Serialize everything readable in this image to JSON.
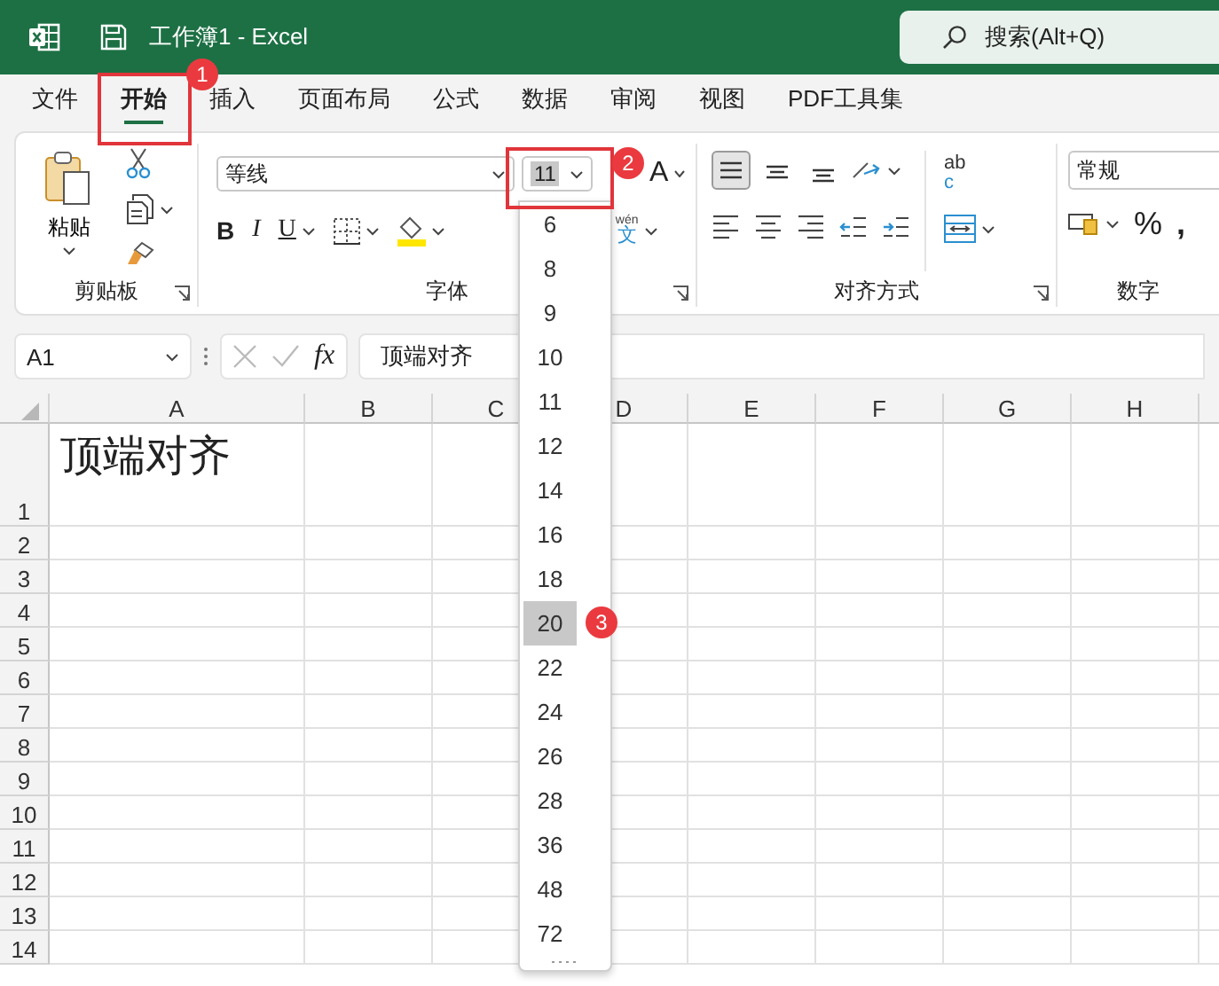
{
  "window": {
    "title": "工作簿1 - Excel"
  },
  "search": {
    "placeholder": "搜索(Alt+Q)"
  },
  "tabs": [
    {
      "label": "文件",
      "selected": false
    },
    {
      "label": "开始",
      "selected": true
    },
    {
      "label": "插入",
      "selected": false
    },
    {
      "label": "页面布局",
      "selected": false
    },
    {
      "label": "公式",
      "selected": false
    },
    {
      "label": "数据",
      "selected": false
    },
    {
      "label": "审阅",
      "selected": false
    },
    {
      "label": "视图",
      "selected": false
    },
    {
      "label": "PDF工具集",
      "selected": false
    }
  ],
  "ribbon": {
    "clipboard": {
      "paste_label": "粘贴",
      "group_label": "剪贴板"
    },
    "font": {
      "font_name": "等线",
      "font_size": "11",
      "grow_label": "A",
      "style_buttons": [
        "B",
        "I",
        "U"
      ],
      "phonetic_top": "wén",
      "phonetic_bottom": "文",
      "group_label": "字体"
    },
    "alignment": {
      "align_buttons": [
        {
          "kind": "top",
          "selected": true
        },
        {
          "kind": "middle",
          "selected": false
        },
        {
          "kind": "bottom",
          "selected": false
        }
      ],
      "wrap_top": "ab",
      "wrap_bottom": "c",
      "group_label": "对齐方式"
    },
    "number": {
      "format": "常规",
      "percent": "%",
      "comma": ",",
      "group_label": "数字"
    }
  },
  "formula_bar": {
    "name_box": "A1",
    "fx_label": "fx",
    "content": "顶端对齐"
  },
  "sheet": {
    "columns": [
      "A",
      "B",
      "C",
      "D",
      "E",
      "F",
      "G",
      "H"
    ],
    "rows": [
      "1",
      "2",
      "3",
      "4",
      "5",
      "6",
      "7",
      "8",
      "9",
      "10",
      "11",
      "12",
      "13",
      "14"
    ],
    "cell_a1": "顶端对齐"
  },
  "font_size_menu": {
    "items": [
      {
        "label": "6",
        "selected": false
      },
      {
        "label": "8",
        "selected": false
      },
      {
        "label": "9",
        "selected": false
      },
      {
        "label": "10",
        "selected": false
      },
      {
        "label": "11",
        "selected": false
      },
      {
        "label": "12",
        "selected": false
      },
      {
        "label": "14",
        "selected": false
      },
      {
        "label": "16",
        "selected": false
      },
      {
        "label": "18",
        "selected": false
      },
      {
        "label": "20",
        "selected": true
      },
      {
        "label": "22",
        "selected": false
      },
      {
        "label": "24",
        "selected": false
      },
      {
        "label": "26",
        "selected": false
      },
      {
        "label": "28",
        "selected": false
      },
      {
        "label": "36",
        "selected": false
      },
      {
        "label": "48",
        "selected": false
      },
      {
        "label": "72",
        "selected": false
      }
    ]
  },
  "annotations": [
    {
      "label": "1"
    },
    {
      "label": "2"
    },
    {
      "label": "3"
    }
  ]
}
